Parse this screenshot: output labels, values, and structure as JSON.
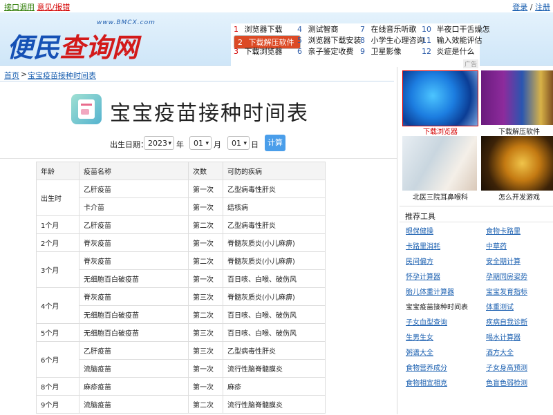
{
  "topbar": {
    "api_link": "接口调用",
    "feedback_link": "意见/报错",
    "login": "登录",
    "sep": "/",
    "register": "注册"
  },
  "logo": {
    "url": "www.BMCX.com",
    "name_part1": "便民",
    "name_part2": "查询网"
  },
  "hot_links": [
    {
      "n": "1",
      "label": "浏览器下载"
    },
    {
      "n": "2",
      "label": "下载解压软件"
    },
    {
      "n": "3",
      "label": "下载浏览器"
    },
    {
      "n": "4",
      "label": "测试智商"
    },
    {
      "n": "5",
      "label": "浏览器下载安装"
    },
    {
      "n": "6",
      "label": "亲子鉴定收费"
    },
    {
      "n": "7",
      "label": "在线音乐听歌"
    },
    {
      "n": "8",
      "label": "小学生心理咨询"
    },
    {
      "n": "9",
      "label": "卫星影像"
    },
    {
      "n": "10",
      "label": "半夜口干舌燥怎"
    },
    {
      "n": "11",
      "label": "输入效能评估"
    },
    {
      "n": "12",
      "label": "炎症是什么"
    }
  ],
  "ad_tag": "广告",
  "breadcrumb": {
    "home": "首页",
    "sep": ">",
    "current": "宝宝疫苗接种时间表"
  },
  "page_title": "宝宝疫苗接种时间表",
  "form": {
    "label": "出生日期：",
    "year": "2023",
    "year_unit": "年",
    "month": "01",
    "month_unit": "月",
    "day": "01",
    "day_unit": "日",
    "button": "计算"
  },
  "table": {
    "headers": [
      "年龄",
      "疫苗名称",
      "次数",
      "可防的疾病"
    ],
    "rows": [
      {
        "age": "出生时",
        "vaccine": "乙肝疫苗",
        "dose": "第一次",
        "disease": "乙型病毒性肝炎"
      },
      {
        "age": "",
        "vaccine": "卡介苗",
        "dose": "第一次",
        "disease": "结核病"
      },
      {
        "age": "1个月",
        "vaccine": "乙肝疫苗",
        "dose": "第二次",
        "disease": "乙型病毒性肝炎"
      },
      {
        "age": "2个月",
        "vaccine": "脊灰疫苗",
        "dose": "第一次",
        "disease": "脊髓灰质炎(小儿麻痹)"
      },
      {
        "age": "3个月",
        "vaccine": "脊灰疫苗",
        "dose": "第二次",
        "disease": "脊髓灰质炎(小儿麻痹)"
      },
      {
        "age": "",
        "vaccine": "无细胞百白破疫苗",
        "dose": "第一次",
        "disease": "百日咳、白喉、破伤风"
      },
      {
        "age": "4个月",
        "vaccine": "脊灰疫苗",
        "dose": "第三次",
        "disease": "脊髓灰质炎(小儿麻痹)"
      },
      {
        "age": "",
        "vaccine": "无细胞百白破疫苗",
        "dose": "第二次",
        "disease": "百日咳、白喉、破伤风"
      },
      {
        "age": "5个月",
        "vaccine": "无细胞百白破疫苗",
        "dose": "第三次",
        "disease": "百日咳、白喉、破伤风"
      },
      {
        "age": "6个月",
        "vaccine": "乙肝疫苗",
        "dose": "第三次",
        "disease": "乙型病毒性肝炎"
      },
      {
        "age": "",
        "vaccine": "流脑疫苗",
        "dose": "第一次",
        "disease": "流行性脑脊髓膜炎"
      },
      {
        "age": "8个月",
        "vaccine": "麻疹疫苗",
        "dose": "第一次",
        "disease": "麻疹"
      },
      {
        "age": "9个月",
        "vaccine": "流脑疫苗",
        "dose": "第二次",
        "disease": "流行性脑脊髓膜炎"
      }
    ]
  },
  "ads": [
    {
      "caption": "下载浏览器",
      "icon": "ie-browser-icon"
    },
    {
      "caption": "下载解压软件",
      "icon": "winrar-icon"
    },
    {
      "caption": "北医三院耳鼻喉科",
      "icon": "doctor-photo"
    },
    {
      "caption": "怎么开发游戏",
      "icon": "tablet-photo"
    }
  ],
  "tools": {
    "heading": "推荐工具",
    "left": [
      "眼保健操",
      "卡路里消耗",
      "民间偏方",
      "怀孕计算器",
      "胎儿体重计算器",
      "宝宝疫苗接种时间表",
      "子女血型查询",
      "生男生女",
      "粥谱大全",
      "食物营养成分",
      "食物相宜相克"
    ],
    "right": [
      "食物卡路里",
      "中草药",
      "安全期计算",
      "孕期同房姿势",
      "宝宝发育指标",
      "体重测试",
      "疾病自我诊断",
      "喝水计算器",
      "酒方大全",
      "子女身高预测",
      "色盲色弱检测"
    ]
  },
  "colors": {
    "link_blue": "#1a5fb0",
    "accent_red": "#d40000",
    "button_blue": "#4a9eea",
    "highlight": "#dc4a25"
  }
}
